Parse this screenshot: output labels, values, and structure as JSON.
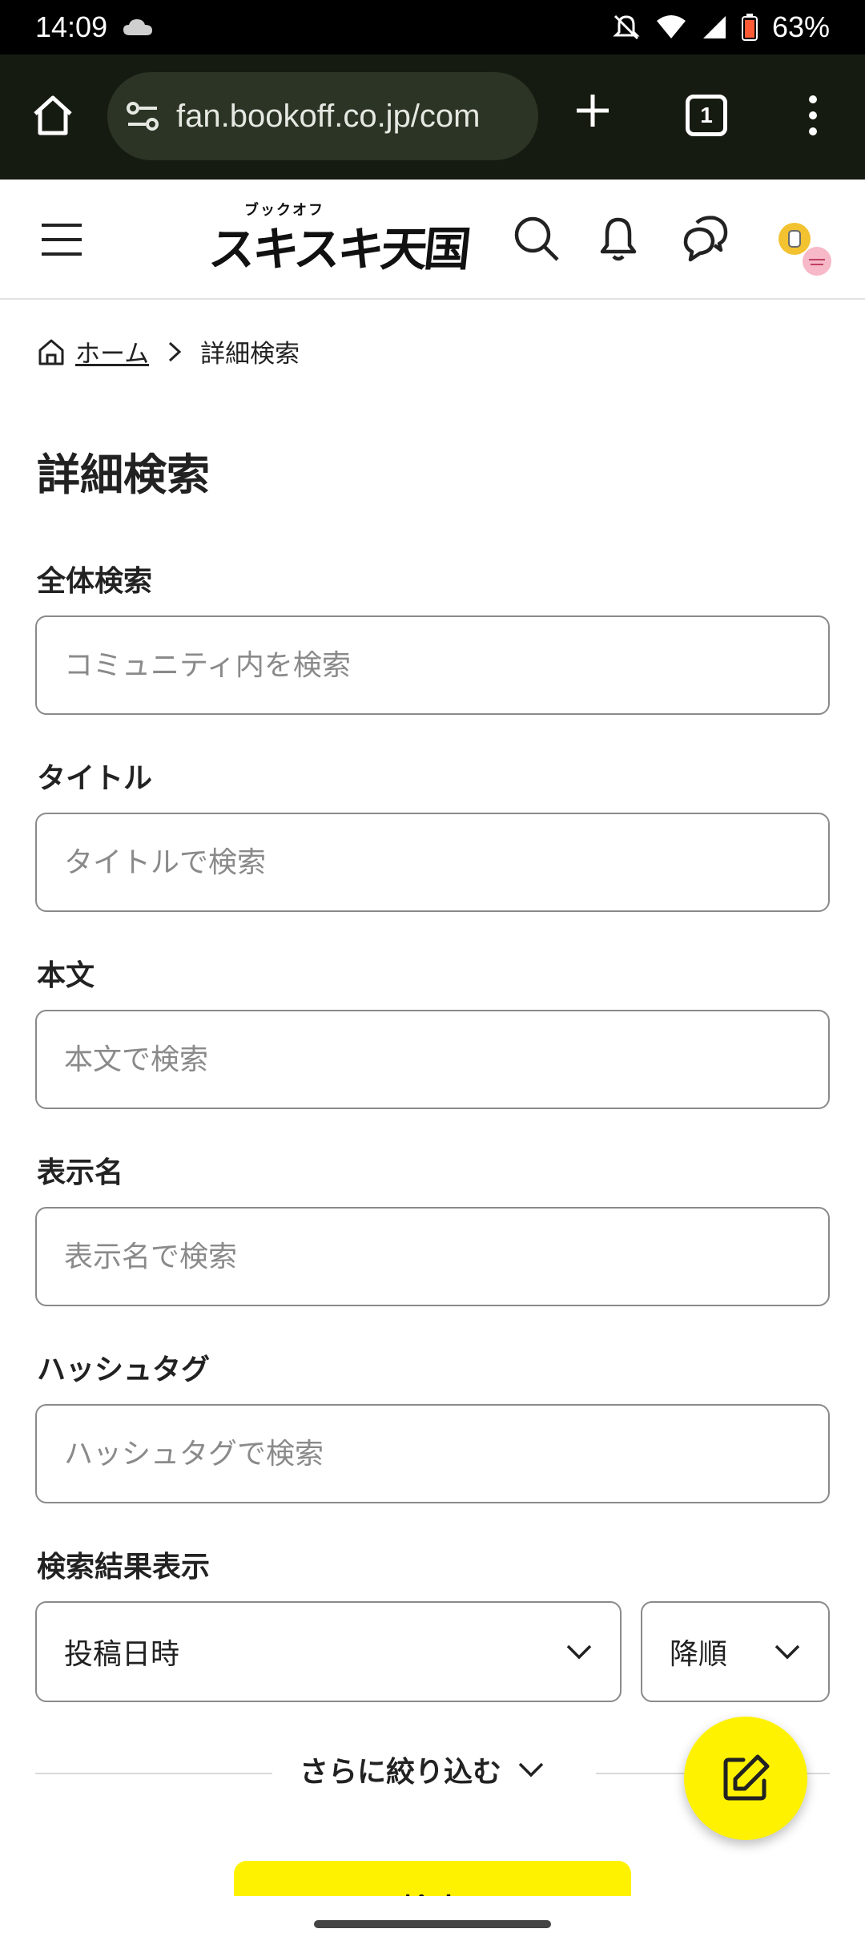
{
  "status_bar": {
    "time": "14:09",
    "battery": "63%"
  },
  "browser": {
    "url": "fan.bookoff.co.jp/com",
    "tab_count": "1"
  },
  "site": {
    "logo_small": "ブックオフ",
    "logo_main": "スキスキ天国"
  },
  "breadcrumb": {
    "home": "ホーム",
    "current": "詳細検索"
  },
  "page": {
    "title": "詳細検索"
  },
  "fields": {
    "all": {
      "label": "全体検索",
      "placeholder": "コミュニティ内を検索"
    },
    "title": {
      "label": "タイトル",
      "placeholder": "タイトルで検索"
    },
    "body": {
      "label": "本文",
      "placeholder": "本文で検索"
    },
    "display_name": {
      "label": "表示名",
      "placeholder": "表示名で検索"
    },
    "hashtag": {
      "label": "ハッシュタグ",
      "placeholder": "ハッシュタグで検索"
    }
  },
  "results": {
    "label": "検索結果表示",
    "sort_field": "投稿日時",
    "sort_order": "降順"
  },
  "refine_label": "さらに絞り込む",
  "search_button": "検索",
  "colors": {
    "accent": "#fff200",
    "browser_bar": "#161b11"
  }
}
